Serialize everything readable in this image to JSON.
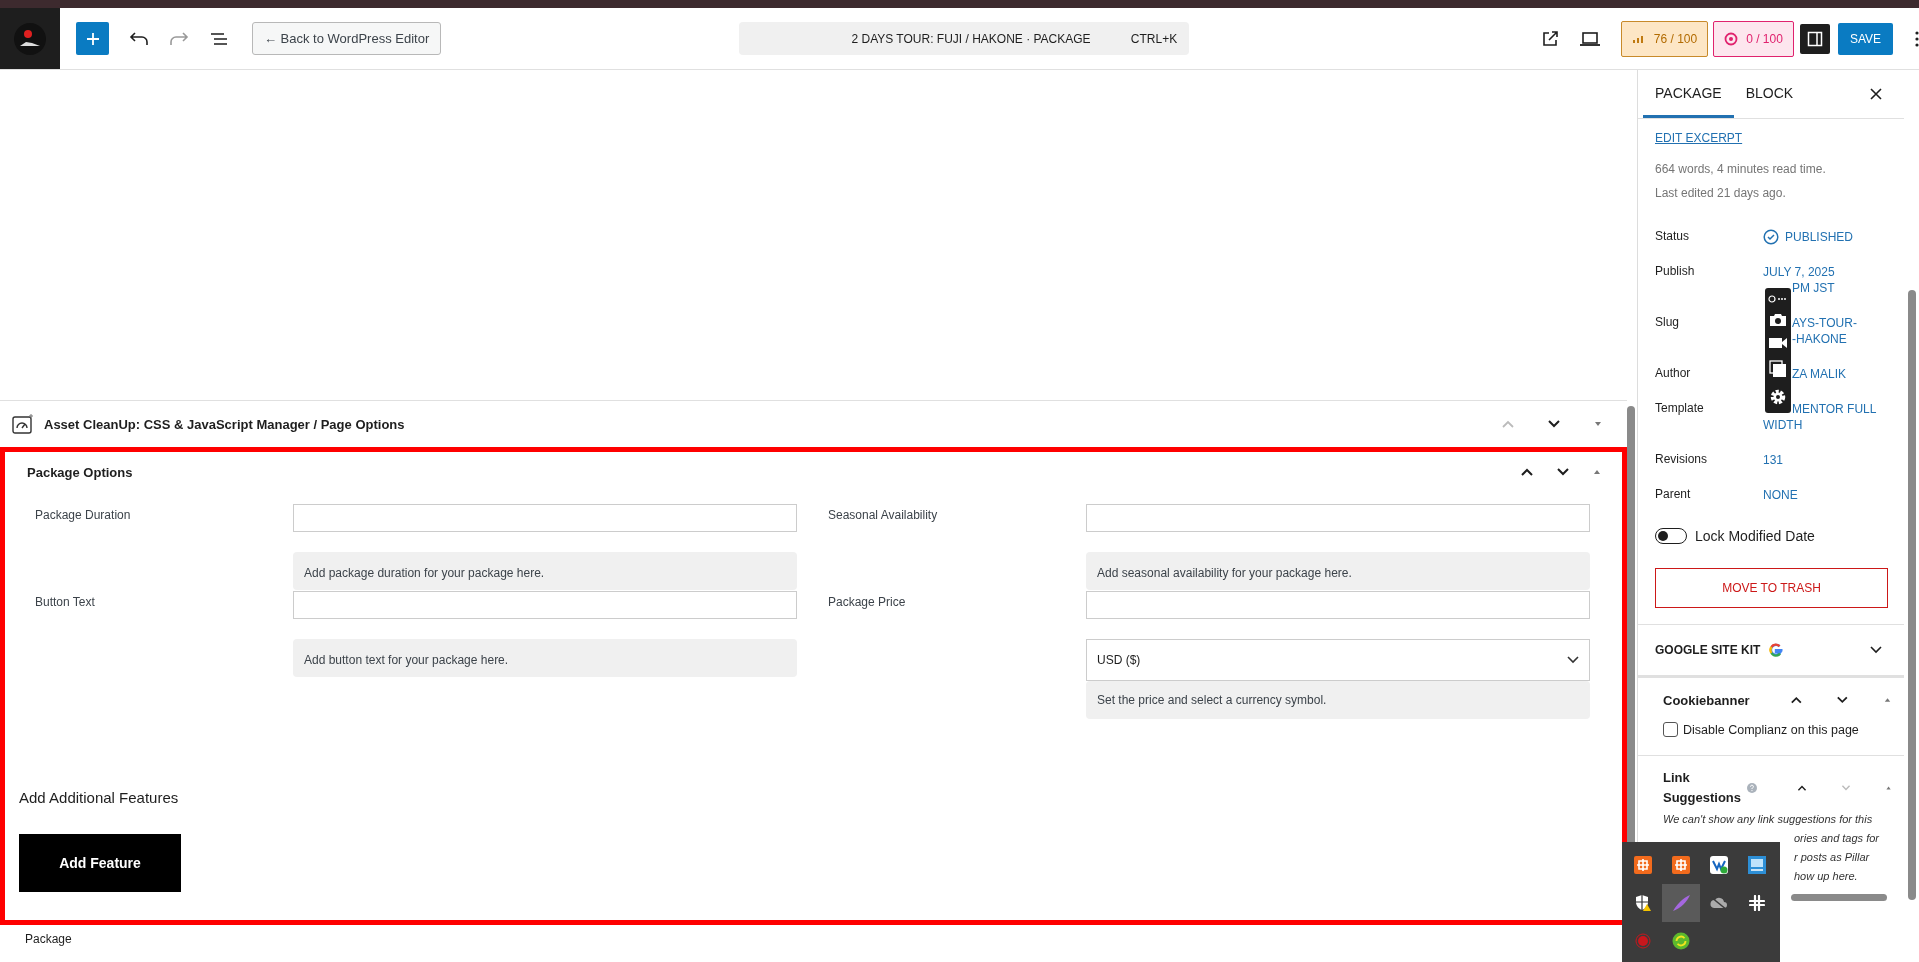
{
  "topbar": {
    "back_button": "← Back to WordPress Editor",
    "command": {
      "title": "2 DAYS TOUR: FUJI / HAKONE · PACKAGE",
      "shortcut": "CTRL+K"
    },
    "seo_score": "76 / 100",
    "readability_score": "0 / 100",
    "save": "SAVE"
  },
  "asset_cleanup": {
    "title": "Asset CleanUp: CSS & JavaScript Manager / Page Options"
  },
  "package_options": {
    "title": "Package Options",
    "fields": [
      {
        "kind": "text",
        "label": "Package Duration",
        "help": "Add package duration for your package here."
      },
      {
        "kind": "text",
        "label": "Seasonal Availability",
        "help": "Add seasonal availability for your package here."
      },
      {
        "kind": "text",
        "label": "Button Text",
        "help": "Add button text for your package here."
      },
      {
        "kind": "price",
        "label": "Package Price",
        "currency": "USD ($)",
        "help": "Set the price and select a currency symbol."
      }
    ],
    "features_title": "Add Additional Features",
    "add_button": "Add Feature"
  },
  "breadcrumb": "Package",
  "sidebar": {
    "tabs": [
      {
        "label": "PACKAGE",
        "selected": true
      },
      {
        "label": "BLOCK",
        "selected": false
      }
    ],
    "edit_excerpt": "EDIT EXCERPT",
    "stats": [
      "664 words, 4 minutes read time.",
      "Last edited 21 days ago."
    ],
    "rows": [
      {
        "label": "Status",
        "lines": [
          "PUBLISHED"
        ]
      },
      {
        "label": "Publish",
        "lines": [
          "JULY 7, 2025",
          "PM JST"
        ]
      },
      {
        "label": "Slug",
        "lines": [
          "AYS-TOUR-",
          "-HAKONE"
        ]
      },
      {
        "label": "Author",
        "lines": [
          "ZA MALIK"
        ]
      },
      {
        "label": "Template",
        "lines": [
          "MENTOR FULL",
          "WIDTH"
        ]
      },
      {
        "label": "Revisions",
        "lines": [
          "131"
        ]
      },
      {
        "label": "Parent",
        "lines": [
          "NONE"
        ]
      }
    ],
    "lock_modified": {
      "label": "Lock Modified Date",
      "on": false
    },
    "trash": "MOVE TO TRASH",
    "site_kit": "GOOGLE SITE KIT",
    "cookiebanner": {
      "title": "Cookiebanner",
      "checkbox": {
        "label": "Disable Complianz on this page",
        "checked": false
      }
    },
    "link_suggestions": {
      "title": "Link Suggestions",
      "lines": [
        "We can't show any link suggestions for this",
        "ories and tags for",
        "r posts as Pillar",
        "how up here."
      ]
    }
  }
}
